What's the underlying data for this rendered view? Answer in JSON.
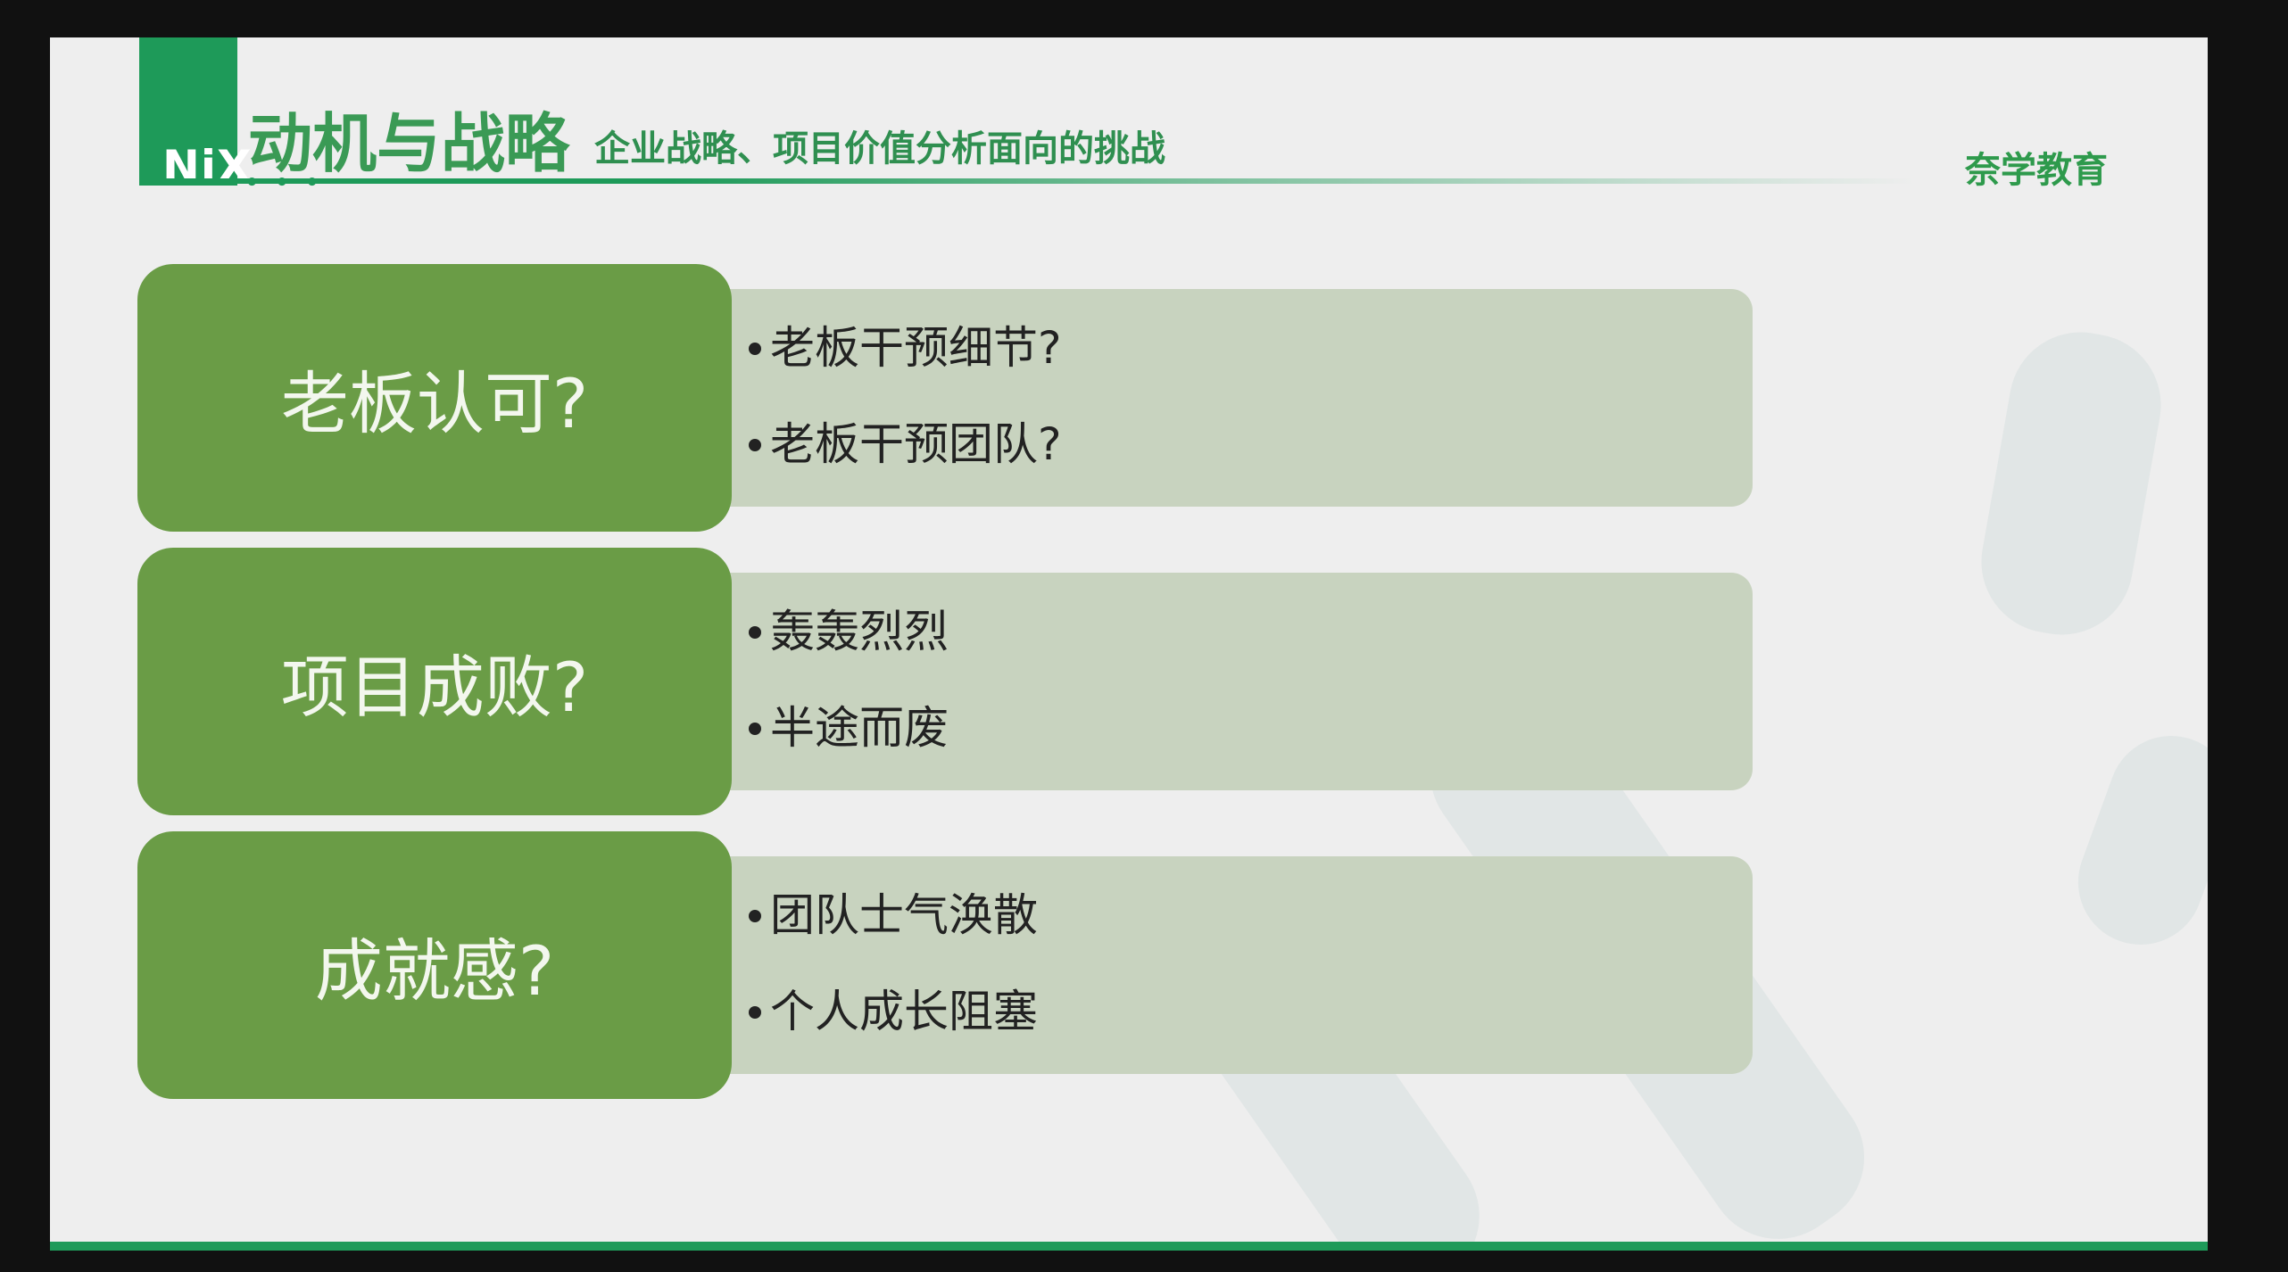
{
  "header": {
    "logo_text": "NiX",
    "logo_dots": "• • •",
    "title": "动机与战略",
    "subtitle": "企业战略、项目价值分析面向的挑战",
    "brand": "奈学教育"
  },
  "rows": [
    {
      "question": "老板认可?",
      "bullets": [
        "老板干预细节?",
        "老板干预团队?"
      ]
    },
    {
      "question": "项目成败?",
      "bullets": [
        "轰轰烈烈",
        "半途而废"
      ]
    },
    {
      "question": "成就感?",
      "bullets": [
        "团队士气涣散",
        "个人成长阻塞"
      ]
    }
  ],
  "colors": {
    "brand_green": "#1e9a59",
    "question_box": "#6a9c46",
    "answer_panel": "#c8d3bf",
    "slide_background": "#eeeeee"
  }
}
